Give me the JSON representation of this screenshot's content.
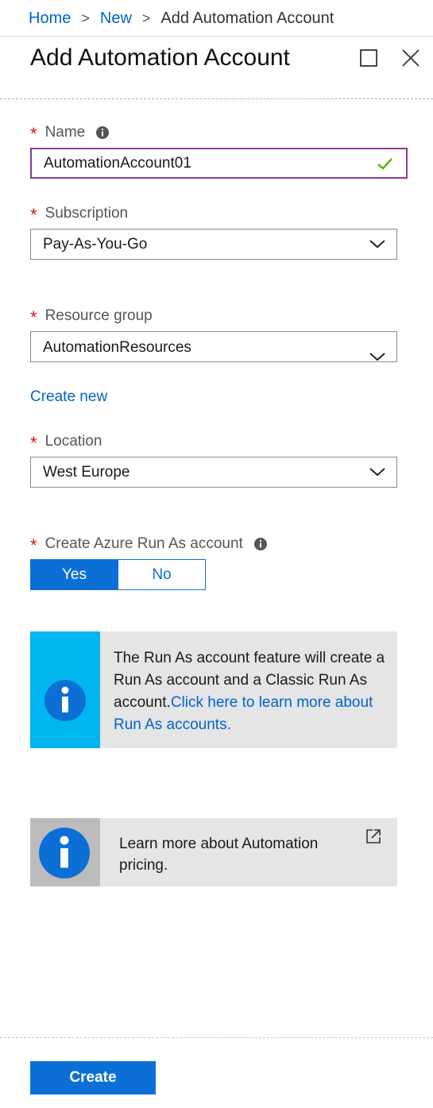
{
  "breadcrumb": {
    "items": [
      "Home",
      "New"
    ],
    "current": "Add Automation Account",
    "separator": ">"
  },
  "header": {
    "title": "Add Automation Account",
    "maximize_icon": "square-icon",
    "close_icon": "x-icon"
  },
  "form": {
    "name": {
      "label": "Name",
      "value": "AutomationAccount01",
      "valid": true
    },
    "subscription": {
      "label": "Subscription",
      "selected": "Pay-As-You-Go"
    },
    "resource_group": {
      "label": "Resource group",
      "selected": "AutomationResources",
      "create_new": "Create new"
    },
    "location": {
      "label": "Location",
      "selected": "West Europe"
    },
    "run_as": {
      "label": "Create Azure Run As account",
      "yes": "Yes",
      "no": "No",
      "selected": "Yes"
    },
    "required_marker": "*"
  },
  "info_run_as": {
    "text": "The Run As account feature will create a Run As account and a Classic Run As account.",
    "link": "Click here to learn more about Run As accounts."
  },
  "info_pricing": {
    "text": "Learn more about Automation pricing."
  },
  "footer": {
    "create_label": "Create"
  },
  "colors": {
    "accent": "#0b6fd6",
    "link": "#0062cc",
    "required": "#e00b1c",
    "valid_check": "#5fb400",
    "info_strip": "#00b5f0",
    "name_border": "#8a3a9a"
  }
}
